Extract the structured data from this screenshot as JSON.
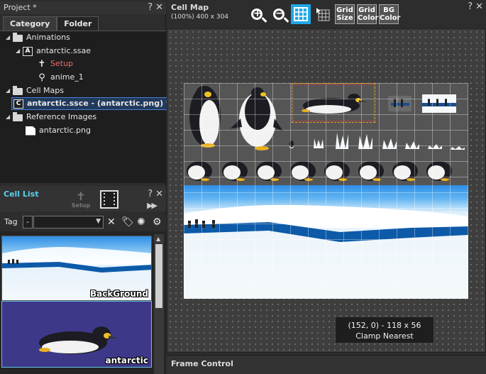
{
  "project": {
    "title": "Project *",
    "tabs": [
      "Category",
      "Folder"
    ],
    "tree": {
      "animations": "Animations",
      "ssae_file": "antarctic.ssae",
      "ssae_badge": "A",
      "setup": "Setup",
      "anime": "anime_1",
      "cell_maps": "Cell Maps",
      "ssce_file": "antarctic.ssce - (antarctic.png) *",
      "ssce_badge": "C",
      "reference_images": "Reference Images",
      "png_file": "antarctic.png"
    }
  },
  "cell_list": {
    "title": "Cell List",
    "setup_label": "Setup",
    "tag_label": "Tag",
    "tag_minus": "-",
    "tag_value": "",
    "cells": [
      {
        "label": "BackGround"
      },
      {
        "label": "antarctic"
      }
    ]
  },
  "cell_map": {
    "title": "Cell Map",
    "size_text": "(100%) 400 x 304",
    "toolbar": {
      "zoom_in": "+",
      "zoom_out": "−",
      "grid_size": [
        "Grid",
        "Size"
      ],
      "grid_color": [
        "Grid",
        "Color"
      ],
      "bg_color": [
        "BG",
        "Color"
      ]
    },
    "info_line1": "(152, 0) - 118 x 56",
    "info_line2": "Clamp  Nearest"
  },
  "frame_control": {
    "title": "Frame Control"
  },
  "window_controls": {
    "help": "?",
    "close": "✕"
  },
  "colors": {
    "accent": "#1fa8e8",
    "cell_list_title": "#5ad0ee",
    "setup_red": "#e86c6c",
    "selection_border": "#4a7fd4",
    "cell_bg": "#3e3888"
  }
}
